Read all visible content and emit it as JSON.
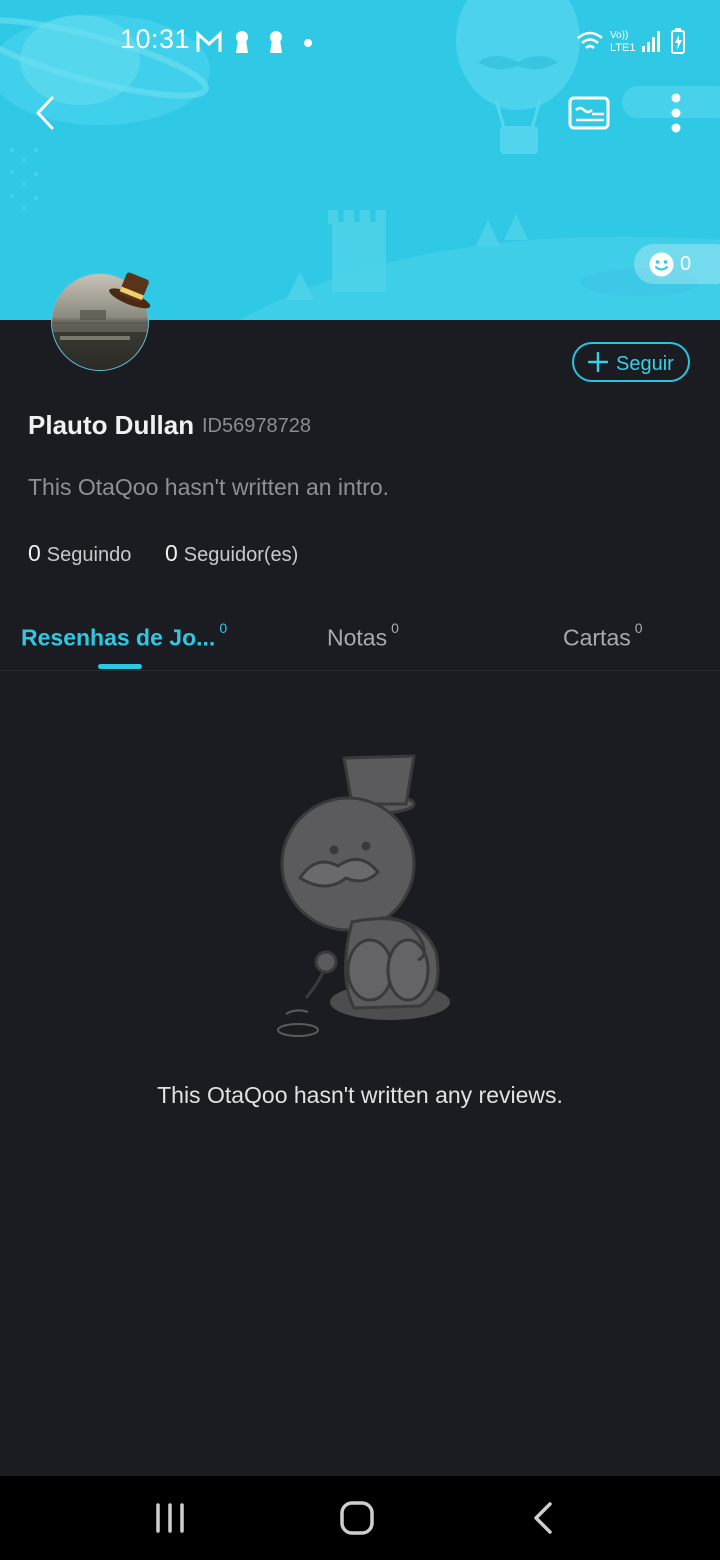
{
  "status_bar": {
    "time": "10:31",
    "left_icons": [
      "gmail-icon",
      "keyhole-icon",
      "keyhole-icon",
      "dot-icon"
    ],
    "right_icons": [
      "wifi-icon",
      "volte-icon",
      "signal-icon",
      "battery-charging-icon"
    ],
    "network_label": "LTE1"
  },
  "app_bar": {
    "back_icon": "chevron-left-icon",
    "card_icon": "id-card-icon",
    "more_icon": "more-vertical-icon"
  },
  "profile": {
    "like_count": "0",
    "follow_label": "Seguir",
    "name": "Plauto Dullan",
    "id": "ID56978728",
    "intro": "This OtaQoo hasn't written an intro.",
    "following_count": "0",
    "following_label": "Seguindo",
    "followers_count": "0",
    "followers_label": "Seguidor(es)"
  },
  "tabs": [
    {
      "label": "Resenhas de Jo...",
      "count": "0",
      "active": true
    },
    {
      "label": "Notas",
      "count": "0",
      "active": false
    },
    {
      "label": "Cartas",
      "count": "0",
      "active": false
    }
  ],
  "empty_state": {
    "message": "This OtaQoo hasn't written any reviews."
  },
  "colors": {
    "banner": "#2fc9e6",
    "accent": "#2fc8e4",
    "background": "#1b1c21"
  }
}
